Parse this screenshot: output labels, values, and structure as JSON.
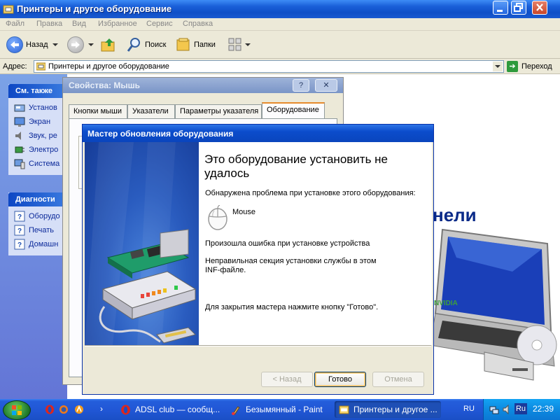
{
  "explorer": {
    "title": "Принтеры и другое оборудование",
    "menu": [
      "Файл",
      "Правка",
      "Вид",
      "Избранное",
      "Сервис",
      "Справка"
    ],
    "toolbar": {
      "back": "Назад",
      "search": "Поиск",
      "folders": "Папки"
    },
    "address": {
      "label": "Адрес:",
      "value": "Принтеры и другое оборудование",
      "go": "Переход"
    },
    "see_also": {
      "title": "См. также",
      "items": [
        "Установ",
        "Экран",
        "Звук, ре",
        "Электро",
        "Система"
      ]
    },
    "diagnostics": {
      "title": "Диагности",
      "items": [
        "Оборудо",
        "Печать",
        "Домашн"
      ]
    },
    "content_heading": "нели"
  },
  "mouse_properties": {
    "title": "Свойства: Мышь",
    "help_btn": "?",
    "close_btn": "✕",
    "tabs": [
      "Кнопки мыши",
      "Указатели",
      "Параметры указателя",
      "Оборудование"
    ],
    "active_tab": "Оборудование"
  },
  "wizard": {
    "title": "Мастер обновления оборудования",
    "heading": "Это оборудование установить не удалось",
    "problem_text": "Обнаружена проблема при установке этого оборудования:",
    "device_name": "Mouse",
    "error_text": "Произошла ошибка при установке устройства",
    "detail_text": "Неправильная секция установки службы в этом INF-файле.",
    "close_hint": "Для закрытия мастера нажмите кнопку \"Готово\".",
    "buttons": {
      "back": "< Назад",
      "finish": "Готово",
      "cancel": "Отмена"
    }
  },
  "laptop_brand": "NVIDIA",
  "taskbar": {
    "tasks": [
      "ADSL club — сообщ...",
      "Безымянный - Paint",
      "Принтеры и другое ..."
    ],
    "active_task": "Принтеры и другое ...",
    "language": "RU",
    "tray_language": "Ru",
    "clock": "22:39"
  }
}
